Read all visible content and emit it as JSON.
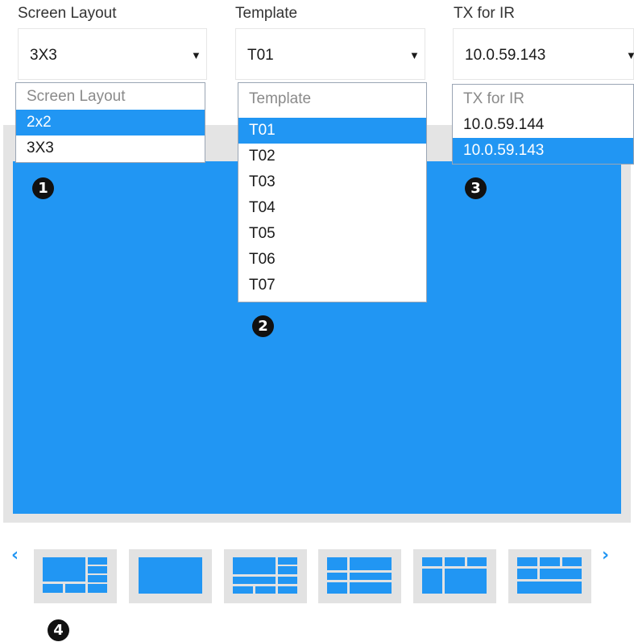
{
  "screen_layout": {
    "label": "Screen Layout",
    "value": "3X3",
    "options": [
      "Screen Layout",
      "2x2",
      "3X3"
    ]
  },
  "template": {
    "label": "Template",
    "value": "T01",
    "options": [
      "Template",
      "T01",
      "T02",
      "T03",
      "T04",
      "T05",
      "T06",
      "T07"
    ]
  },
  "tx_for_ir": {
    "label": "TX for IR",
    "value": "10.0.59.143",
    "options": [
      "TX for IR",
      "10.0.59.144",
      "10.0.59.143"
    ]
  },
  "caret_glyph": "▼",
  "badges": {
    "one": "1",
    "two": "2",
    "three": "3",
    "four": "4"
  },
  "carousel": {
    "prev_glyph": "‹",
    "next_glyph": "›"
  },
  "icons": {
    "prev": "chevron-left-icon",
    "next": "chevron-right-icon",
    "caret": "caret-down-icon"
  },
  "colors": {
    "accent": "#2196f3",
    "frame": "#e4e4e4",
    "thumb_bg": "#e2e2e2",
    "badge": "#111111"
  }
}
